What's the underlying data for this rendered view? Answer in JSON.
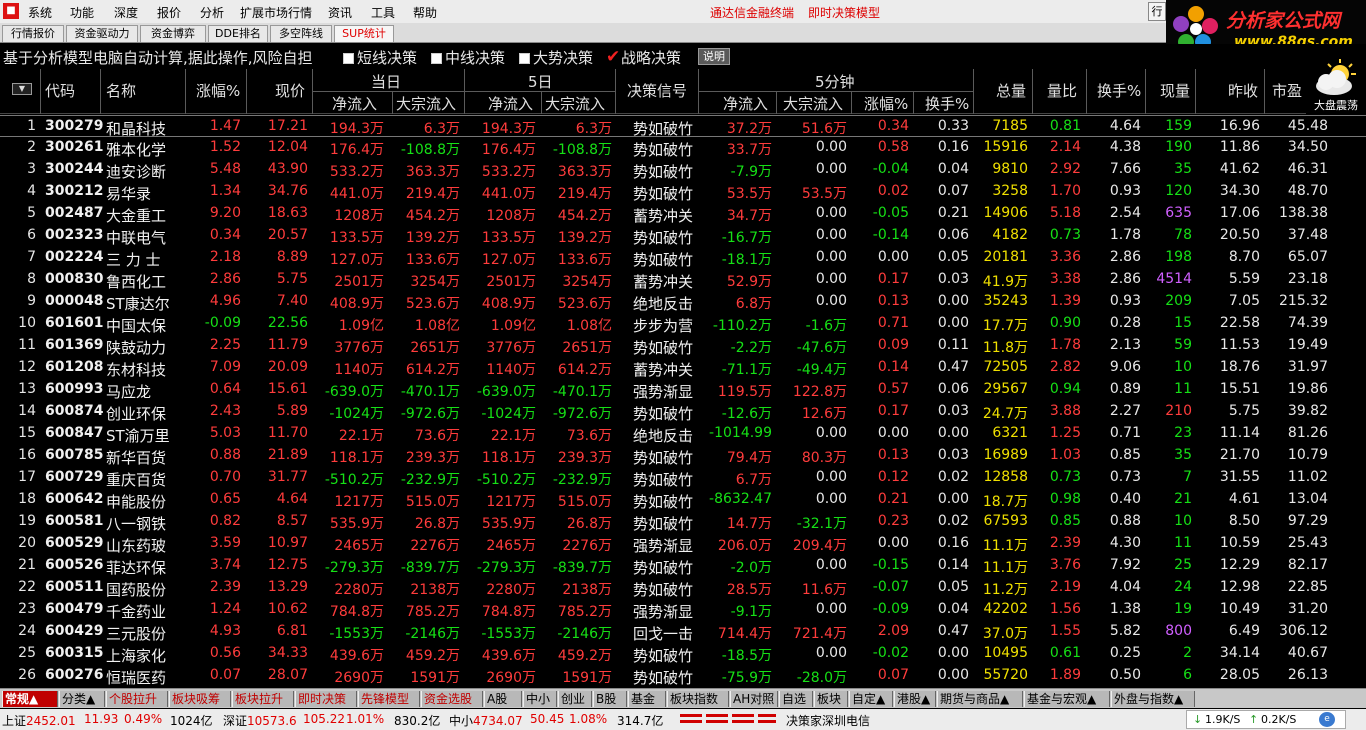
{
  "menu": {
    "items": [
      "系统",
      "功能",
      "深度",
      "报价",
      "分析",
      "扩展市场行情",
      "资讯",
      "工具",
      "帮助"
    ],
    "title_left": "通达信金融终端",
    "title_right": "即时决策模型",
    "tail": "行"
  },
  "logo": {
    "name": "分析家公式网",
    "url": "www.88gs.com"
  },
  "tabs": [
    "行情报价",
    "资金驱动力",
    "资金博弈",
    "DDE排名",
    "多空阵线",
    "SUP统计"
  ],
  "active_tab": "SUP统计",
  "options": {
    "hint": "基于分析模型电脑自动计算,据此操作,风险自担",
    "short": "短线决策",
    "mid": "中线决策",
    "trend": "大势决策",
    "strategy": "战略决策",
    "explain": "说明"
  },
  "weather_label": "大盘震荡",
  "headers": {
    "code": "代码",
    "name": "名称",
    "pct": "涨幅%",
    "price": "现价",
    "today": "当日",
    "five": "5日",
    "netflow": "净流入",
    "bulkflow": "大宗流入",
    "signal": "决策信号",
    "five_min": "5分钟",
    "pct5": "涨幅%",
    "turn5": "换手%",
    "vol": "总量",
    "vr": "量比",
    "turnover": "换手%",
    "cur": "现量",
    "prev": "昨收",
    "pe": "市盈"
  },
  "rows": [
    {
      "code": "300279",
      "name": "和晶科技",
      "pct": "1.47",
      "price": "17.21",
      "d_net": "194.3万",
      "d_bulk": "6.3万",
      "w_net": "194.3万",
      "w_bulk": "6.3万",
      "signal": "势如破竹",
      "m_net": "37.2万",
      "m_bulk": "51.6万",
      "m_pct": "0.34",
      "m_turn": "0.33",
      "vol": "7185",
      "vr": "0.81",
      "turn": "4.64",
      "cur": "159",
      "prev": "16.96",
      "pe": "45.48"
    },
    {
      "code": "300261",
      "name": "雅本化学",
      "pct": "1.52",
      "price": "12.04",
      "d_net": "176.4万",
      "d_bulk": "-108.8万",
      "w_net": "176.4万",
      "w_bulk": "-108.8万",
      "signal": "势如破竹",
      "m_net": "33.7万",
      "m_bulk": "0.00",
      "m_pct": "0.58",
      "m_turn": "0.16",
      "vol": "15916",
      "vr": "2.14",
      "turn": "4.38",
      "cur": "190",
      "prev": "11.86",
      "pe": "34.50"
    },
    {
      "code": "300244",
      "name": "迪安诊断",
      "pct": "5.48",
      "price": "43.90",
      "d_net": "533.2万",
      "d_bulk": "363.3万",
      "w_net": "533.2万",
      "w_bulk": "363.3万",
      "signal": "势如破竹",
      "m_net": "-7.9万",
      "m_bulk": "0.00",
      "m_pct": "-0.04",
      "m_turn": "0.04",
      "vol": "9810",
      "vr": "2.92",
      "turn": "7.66",
      "cur": "35",
      "prev": "41.62",
      "pe": "46.31"
    },
    {
      "code": "300212",
      "name": "易华录",
      "pct": "1.34",
      "price": "34.76",
      "d_net": "441.0万",
      "d_bulk": "219.4万",
      "w_net": "441.0万",
      "w_bulk": "219.4万",
      "signal": "势如破竹",
      "m_net": "53.5万",
      "m_bulk": "53.5万",
      "m_pct": "0.02",
      "m_turn": "0.07",
      "vol": "3258",
      "vr": "1.70",
      "turn": "0.93",
      "cur": "120",
      "prev": "34.30",
      "pe": "48.70"
    },
    {
      "code": "002487",
      "name": "大金重工",
      "pct": "9.20",
      "price": "18.63",
      "d_net": "1208万",
      "d_bulk": "454.2万",
      "w_net": "1208万",
      "w_bulk": "454.2万",
      "signal": "蓄势冲关",
      "m_net": "34.7万",
      "m_bulk": "0.00",
      "m_pct": "-0.05",
      "m_turn": "0.21",
      "vol": "14906",
      "vr": "5.18",
      "turn": "2.54",
      "cur": "635",
      "prev": "17.06",
      "pe": "138.38"
    },
    {
      "code": "002323",
      "name": "中联电气",
      "pct": "0.34",
      "price": "20.57",
      "d_net": "133.5万",
      "d_bulk": "139.2万",
      "w_net": "133.5万",
      "w_bulk": "139.2万",
      "signal": "势如破竹",
      "m_net": "-16.7万",
      "m_bulk": "0.00",
      "m_pct": "-0.14",
      "m_turn": "0.06",
      "vol": "4182",
      "vr": "0.73",
      "turn": "1.78",
      "cur": "78",
      "prev": "20.50",
      "pe": "37.48"
    },
    {
      "code": "002224",
      "name": "三 力 士",
      "pct": "2.18",
      "price": "8.89",
      "d_net": "127.0万",
      "d_bulk": "133.6万",
      "w_net": "127.0万",
      "w_bulk": "133.6万",
      "signal": "势如破竹",
      "m_net": "-18.1万",
      "m_bulk": "0.00",
      "m_pct": "0.00",
      "m_turn": "0.05",
      "vol": "20181",
      "vr": "3.36",
      "turn": "2.86",
      "cur": "198",
      "prev": "8.70",
      "pe": "65.07"
    },
    {
      "code": "000830",
      "name": "鲁西化工",
      "pct": "2.86",
      "price": "5.75",
      "d_net": "2501万",
      "d_bulk": "3254万",
      "w_net": "2501万",
      "w_bulk": "3254万",
      "signal": "蓄势冲关",
      "m_net": "52.9万",
      "m_bulk": "0.00",
      "m_pct": "0.17",
      "m_turn": "0.03",
      "vol": "41.9万",
      "vr": "3.38",
      "turn": "2.86",
      "cur": "4514",
      "prev": "5.59",
      "pe": "23.18"
    },
    {
      "code": "000048",
      "name": "ST康达尔",
      "pct": "4.96",
      "price": "7.40",
      "d_net": "408.9万",
      "d_bulk": "523.6万",
      "w_net": "408.9万",
      "w_bulk": "523.6万",
      "signal": "绝地反击",
      "m_net": "6.8万",
      "m_bulk": "0.00",
      "m_pct": "0.13",
      "m_turn": "0.00",
      "vol": "35243",
      "vr": "1.39",
      "turn": "0.93",
      "cur": "209",
      "prev": "7.05",
      "pe": "215.32"
    },
    {
      "code": "601601",
      "name": "中国太保",
      "pct": "-0.09",
      "price": "22.56",
      "d_net": "1.09亿",
      "d_bulk": "1.08亿",
      "w_net": "1.09亿",
      "w_bulk": "1.08亿",
      "signal": "步步为营",
      "m_net": "-110.2万",
      "m_bulk": "-1.6万",
      "m_pct": "0.71",
      "m_turn": "0.00",
      "vol": "17.7万",
      "vr": "0.90",
      "turn": "0.28",
      "cur": "15",
      "prev": "22.58",
      "pe": "74.39"
    },
    {
      "code": "601369",
      "name": "陕鼓动力",
      "pct": "2.25",
      "price": "11.79",
      "d_net": "3776万",
      "d_bulk": "2651万",
      "w_net": "3776万",
      "w_bulk": "2651万",
      "signal": "势如破竹",
      "m_net": "-2.2万",
      "m_bulk": "-47.6万",
      "m_pct": "0.09",
      "m_turn": "0.11",
      "vol": "11.8万",
      "vr": "1.78",
      "turn": "2.13",
      "cur": "59",
      "prev": "11.53",
      "pe": "19.49"
    },
    {
      "code": "601208",
      "name": "东材科技",
      "pct": "7.09",
      "price": "20.09",
      "d_net": "1140万",
      "d_bulk": "614.2万",
      "w_net": "1140万",
      "w_bulk": "614.2万",
      "signal": "蓄势冲关",
      "m_net": "-71.1万",
      "m_bulk": "-49.4万",
      "m_pct": "0.14",
      "m_turn": "0.47",
      "vol": "72505",
      "vr": "2.82",
      "turn": "9.06",
      "cur": "10",
      "prev": "18.76",
      "pe": "31.97"
    },
    {
      "code": "600993",
      "name": "马应龙",
      "pct": "0.64",
      "price": "15.61",
      "d_net": "-639.0万",
      "d_bulk": "-470.1万",
      "w_net": "-639.0万",
      "w_bulk": "-470.1万",
      "signal": "强势渐显",
      "m_net": "119.5万",
      "m_bulk": "122.8万",
      "m_pct": "0.57",
      "m_turn": "0.06",
      "vol": "29567",
      "vr": "0.94",
      "turn": "0.89",
      "cur": "11",
      "prev": "15.51",
      "pe": "19.86"
    },
    {
      "code": "600874",
      "name": "创业环保",
      "pct": "2.43",
      "price": "5.89",
      "d_net": "-1024万",
      "d_bulk": "-972.6万",
      "w_net": "-1024万",
      "w_bulk": "-972.6万",
      "signal": "势如破竹",
      "m_net": "-12.6万",
      "m_bulk": "12.6万",
      "m_pct": "0.17",
      "m_turn": "0.03",
      "vol": "24.7万",
      "vr": "3.88",
      "turn": "2.27",
      "cur": "210",
      "prev": "5.75",
      "pe": "39.82"
    },
    {
      "code": "600847",
      "name": "ST渝万里",
      "pct": "5.03",
      "price": "11.70",
      "d_net": "22.1万",
      "d_bulk": "73.6万",
      "w_net": "22.1万",
      "w_bulk": "73.6万",
      "signal": "绝地反击",
      "m_net": "-1014.99",
      "m_bulk": "0.00",
      "m_pct": "0.00",
      "m_turn": "0.00",
      "vol": "6321",
      "vr": "1.25",
      "turn": "0.71",
      "cur": "23",
      "prev": "11.14",
      "pe": "81.26"
    },
    {
      "code": "600785",
      "name": "新华百货",
      "pct": "0.88",
      "price": "21.89",
      "d_net": "118.1万",
      "d_bulk": "239.3万",
      "w_net": "118.1万",
      "w_bulk": "239.3万",
      "signal": "势如破竹",
      "m_net": "79.4万",
      "m_bulk": "80.3万",
      "m_pct": "0.13",
      "m_turn": "0.03",
      "vol": "16989",
      "vr": "1.03",
      "turn": "0.85",
      "cur": "35",
      "prev": "21.70",
      "pe": "10.79"
    },
    {
      "code": "600729",
      "name": "重庆百货",
      "pct": "0.70",
      "price": "31.77",
      "d_net": "-510.2万",
      "d_bulk": "-232.9万",
      "w_net": "-510.2万",
      "w_bulk": "-232.9万",
      "signal": "势如破竹",
      "m_net": "6.7万",
      "m_bulk": "0.00",
      "m_pct": "0.12",
      "m_turn": "0.02",
      "vol": "12858",
      "vr": "0.73",
      "turn": "0.73",
      "cur": "7",
      "prev": "31.55",
      "pe": "11.02"
    },
    {
      "code": "600642",
      "name": "申能股份",
      "pct": "0.65",
      "price": "4.64",
      "d_net": "1217万",
      "d_bulk": "515.0万",
      "w_net": "1217万",
      "w_bulk": "515.0万",
      "signal": "势如破竹",
      "m_net": "-8632.47",
      "m_bulk": "0.00",
      "m_pct": "0.21",
      "m_turn": "0.00",
      "vol": "18.7万",
      "vr": "0.98",
      "turn": "0.40",
      "cur": "21",
      "prev": "4.61",
      "pe": "13.04"
    },
    {
      "code": "600581",
      "name": "八一钢铁",
      "pct": "0.82",
      "price": "8.57",
      "d_net": "535.9万",
      "d_bulk": "26.8万",
      "w_net": "535.9万",
      "w_bulk": "26.8万",
      "signal": "势如破竹",
      "m_net": "14.7万",
      "m_bulk": "-32.1万",
      "m_pct": "0.23",
      "m_turn": "0.02",
      "vol": "67593",
      "vr": "0.85",
      "turn": "0.88",
      "cur": "10",
      "prev": "8.50",
      "pe": "97.29"
    },
    {
      "code": "600529",
      "name": "山东药玻",
      "pct": "3.59",
      "price": "10.97",
      "d_net": "2465万",
      "d_bulk": "2276万",
      "w_net": "2465万",
      "w_bulk": "2276万",
      "signal": "强势渐显",
      "m_net": "206.0万",
      "m_bulk": "209.4万",
      "m_pct": "0.00",
      "m_turn": "0.16",
      "vol": "11.1万",
      "vr": "2.39",
      "turn": "4.30",
      "cur": "11",
      "prev": "10.59",
      "pe": "25.43"
    },
    {
      "code": "600526",
      "name": "菲达环保",
      "pct": "3.74",
      "price": "12.75",
      "d_net": "-279.3万",
      "d_bulk": "-839.7万",
      "w_net": "-279.3万",
      "w_bulk": "-839.7万",
      "signal": "势如破竹",
      "m_net": "-2.0万",
      "m_bulk": "0.00",
      "m_pct": "-0.15",
      "m_turn": "0.14",
      "vol": "11.1万",
      "vr": "3.76",
      "turn": "7.92",
      "cur": "25",
      "prev": "12.29",
      "pe": "82.17"
    },
    {
      "code": "600511",
      "name": "国药股份",
      "pct": "2.39",
      "price": "13.29",
      "d_net": "2280万",
      "d_bulk": "2138万",
      "w_net": "2280万",
      "w_bulk": "2138万",
      "signal": "势如破竹",
      "m_net": "28.5万",
      "m_bulk": "11.6万",
      "m_pct": "-0.07",
      "m_turn": "0.05",
      "vol": "11.2万",
      "vr": "2.19",
      "turn": "4.04",
      "cur": "24",
      "prev": "12.98",
      "pe": "22.85"
    },
    {
      "code": "600479",
      "name": "千金药业",
      "pct": "1.24",
      "price": "10.62",
      "d_net": "784.8万",
      "d_bulk": "785.2万",
      "w_net": "784.8万",
      "w_bulk": "785.2万",
      "signal": "强势渐显",
      "m_net": "-9.1万",
      "m_bulk": "0.00",
      "m_pct": "-0.09",
      "m_turn": "0.04",
      "vol": "42202",
      "vr": "1.56",
      "turn": "1.38",
      "cur": "19",
      "prev": "10.49",
      "pe": "31.20"
    },
    {
      "code": "600429",
      "name": "三元股份",
      "pct": "4.93",
      "price": "6.81",
      "d_net": "-1553万",
      "d_bulk": "-2146万",
      "w_net": "-1553万",
      "w_bulk": "-2146万",
      "signal": "回戈一击",
      "m_net": "714.4万",
      "m_bulk": "721.4万",
      "m_pct": "2.09",
      "m_turn": "0.47",
      "vol": "37.0万",
      "vr": "1.55",
      "turn": "5.82",
      "cur": "800",
      "prev": "6.49",
      "pe": "306.12"
    },
    {
      "code": "600315",
      "name": "上海家化",
      "pct": "0.56",
      "price": "34.33",
      "d_net": "439.6万",
      "d_bulk": "459.2万",
      "w_net": "439.6万",
      "w_bulk": "459.2万",
      "signal": "势如破竹",
      "m_net": "-18.5万",
      "m_bulk": "0.00",
      "m_pct": "-0.02",
      "m_turn": "0.00",
      "vol": "10495",
      "vr": "0.61",
      "turn": "0.25",
      "cur": "2",
      "prev": "34.14",
      "pe": "40.67"
    },
    {
      "code": "600276",
      "name": "恒瑞医药",
      "pct": "0.07",
      "price": "28.07",
      "d_net": "2690万",
      "d_bulk": "1591万",
      "w_net": "2690万",
      "w_bulk": "1591万",
      "signal": "势如破竹",
      "m_net": "-75.9万",
      "m_bulk": "-28.0万",
      "m_pct": "0.07",
      "m_turn": "0.00",
      "vol": "55720",
      "vr": "1.89",
      "turn": "0.50",
      "cur": "6",
      "prev": "28.05",
      "pe": "26.13"
    }
  ],
  "bottom_tabs": [
    "常规▲",
    "分类▲",
    "个股拉升",
    "板块吸筹",
    "板块拉升",
    "即时决策",
    "先锋模型",
    "资金选股",
    "A股",
    "中小",
    "创业",
    "B股",
    "基金",
    "板块指数",
    "AH对照",
    "自选",
    "板块",
    "自定▲",
    "港股▲",
    "期货与商品▲",
    "基金与宏观▲",
    "外盘与指数▲"
  ],
  "status": {
    "sh_label": "上证",
    "sh_val": "2452.01",
    "sh_chg": "11.93",
    "sh_pct": "0.49%",
    "sh_amt": "1024亿",
    "sz_label": "深证",
    "sz_val": "10573.6",
    "sz_chg": "105.22",
    "sz_pct": "1.01%",
    "sz_amt": "830.2亿",
    "zx_label": "中小",
    "zx_val": "4734.07",
    "zx_chg": "50.45",
    "zx_pct": "1.08%",
    "zx_amt": "314.7亿",
    "broker": "决策家深圳电信",
    "down": "1.9K/S",
    "up": "0.2K/S"
  }
}
